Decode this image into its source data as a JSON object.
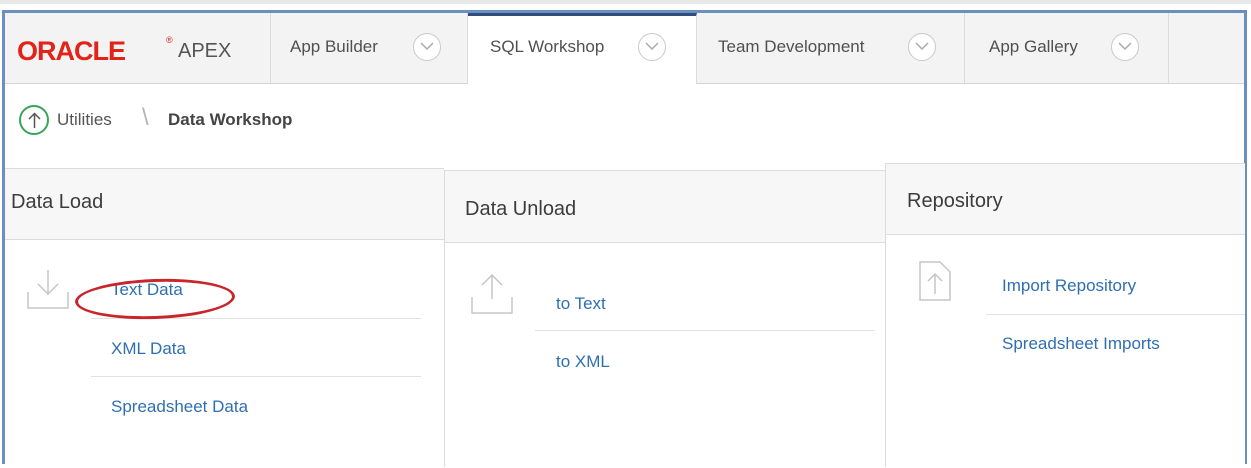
{
  "nav": {
    "logo_oracle": "ORACLE",
    "logo_reg": "®",
    "logo_apex": "APEX",
    "tabs": [
      {
        "label": "App Builder"
      },
      {
        "label": "SQL Workshop"
      },
      {
        "label": "Team Development"
      },
      {
        "label": "App Gallery"
      }
    ]
  },
  "breadcrumb": {
    "parent": "Utilities",
    "separator": "\\",
    "current": "Data Workshop"
  },
  "data_load": {
    "title": "Data Load",
    "links": [
      "Text Data",
      "XML Data",
      "Spreadsheet Data"
    ]
  },
  "data_unload": {
    "title": "Data Unload",
    "links": [
      "to Text",
      "to XML"
    ]
  },
  "repository": {
    "title": "Repository",
    "links": [
      "Import Repository",
      "Spreadsheet Imports"
    ]
  },
  "colors": {
    "brand_red": "#e2231a",
    "link_blue": "#2f6fb1",
    "frame_blue": "#6d8fbf",
    "up_green": "#3aa55a",
    "annotation_red": "#c8262c"
  }
}
